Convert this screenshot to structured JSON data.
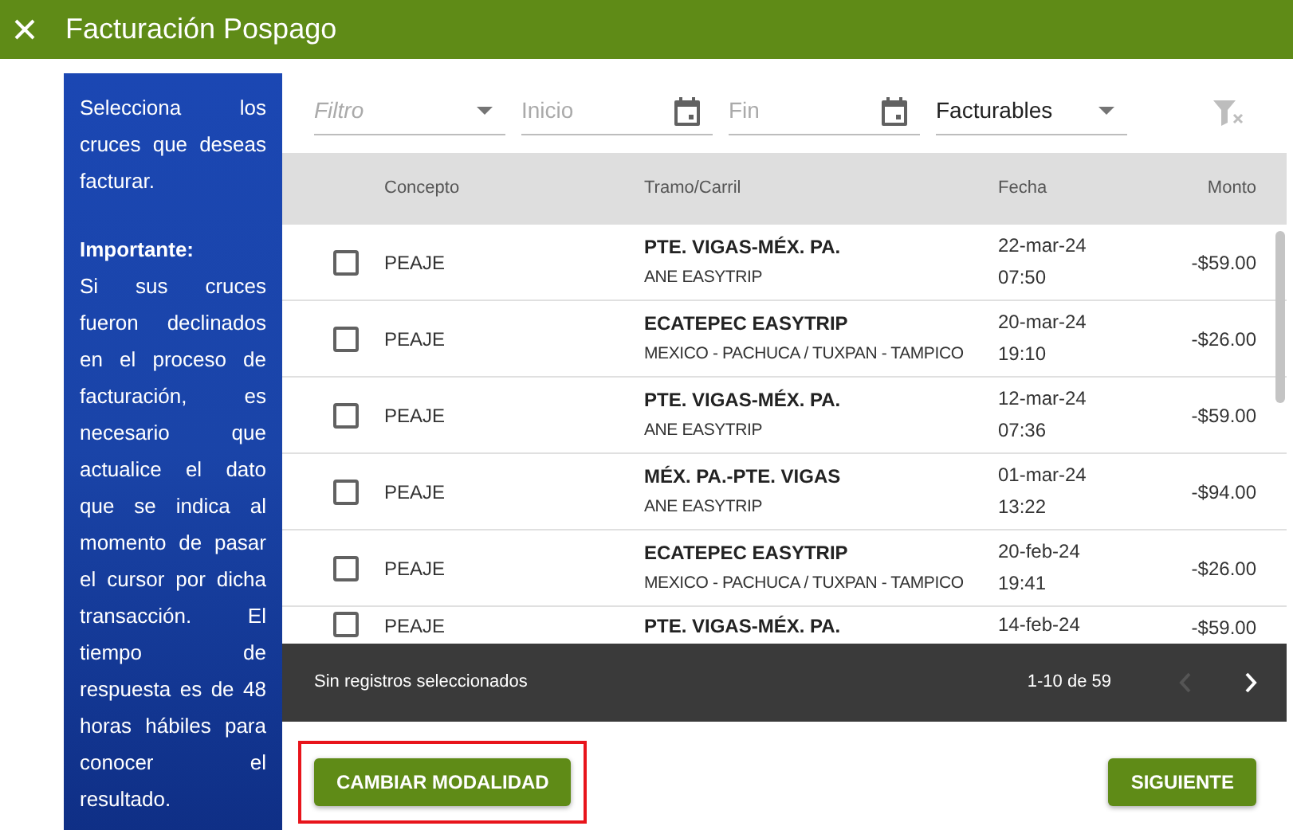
{
  "window": {
    "title": "Facturación Pospago"
  },
  "info_panel": {
    "intro": "Selecciona los cruces que deseas facturar.",
    "heading": "Importante:",
    "body": "Si sus cruces fueron declinados en el proceso de facturación, es necesario que actualice el dato que se indica al momento de pasar el cursor por dicha transacción. El tiempo de respuesta es de 48 horas hábiles para conocer el resultado."
  },
  "filters": [
    {
      "kind": "select",
      "placeholder": "Filtro"
    },
    {
      "kind": "date",
      "placeholder": "Inicio"
    },
    {
      "kind": "date",
      "placeholder": "Fin"
    },
    {
      "kind": "select",
      "value": "Facturables"
    }
  ],
  "clear_filters": {
    "disabled": true
  },
  "table": {
    "columns": [
      "Concepto",
      "Tramo/Carril",
      "Fecha",
      "Monto"
    ],
    "rows": [
      {
        "checked": false,
        "concept": "PEAJE",
        "route": "PTE. VIGAS-MÉX. PA.",
        "lane": "ANE EASYTRIP",
        "date": "22-mar-24",
        "time": "07:50",
        "amount": "-$59.00"
      },
      {
        "checked": false,
        "concept": "PEAJE",
        "route": "ECATEPEC EASYTRIP",
        "lane": "MEXICO - PACHUCA / TUXPAN - TAMPICO",
        "date": "20-mar-24",
        "time": "19:10",
        "amount": "-$26.00"
      },
      {
        "checked": false,
        "concept": "PEAJE",
        "route": "PTE. VIGAS-MÉX. PA.",
        "lane": "ANE EASYTRIP",
        "date": "12-mar-24",
        "time": "07:36",
        "amount": "-$59.00"
      },
      {
        "checked": false,
        "concept": "PEAJE",
        "route": "MÉX. PA.-PTE. VIGAS",
        "lane": "ANE EASYTRIP",
        "date": "01-mar-24",
        "time": "13:22",
        "amount": "-$94.00"
      },
      {
        "checked": false,
        "concept": "PEAJE",
        "route": "ECATEPEC EASYTRIP",
        "lane": "MEXICO - PACHUCA / TUXPAN - TAMPICO",
        "date": "20-feb-24",
        "time": "19:41",
        "amount": "-$26.00"
      },
      {
        "checked": false,
        "concept": "PEAJE",
        "route": "PTE. VIGAS-MÉX. PA.",
        "date": "14-feb-24",
        "amount": "-$59.00"
      }
    ]
  },
  "footer": {
    "selection": "Sin registros seleccionados",
    "range": "1-10 de 59",
    "prev_disabled": true,
    "next_disabled": false
  },
  "buttons": [
    {
      "label": "CAMBIAR MODALIDAD",
      "highlighted": true
    },
    {
      "label": "SIGUIENTE",
      "highlighted": false
    }
  ]
}
